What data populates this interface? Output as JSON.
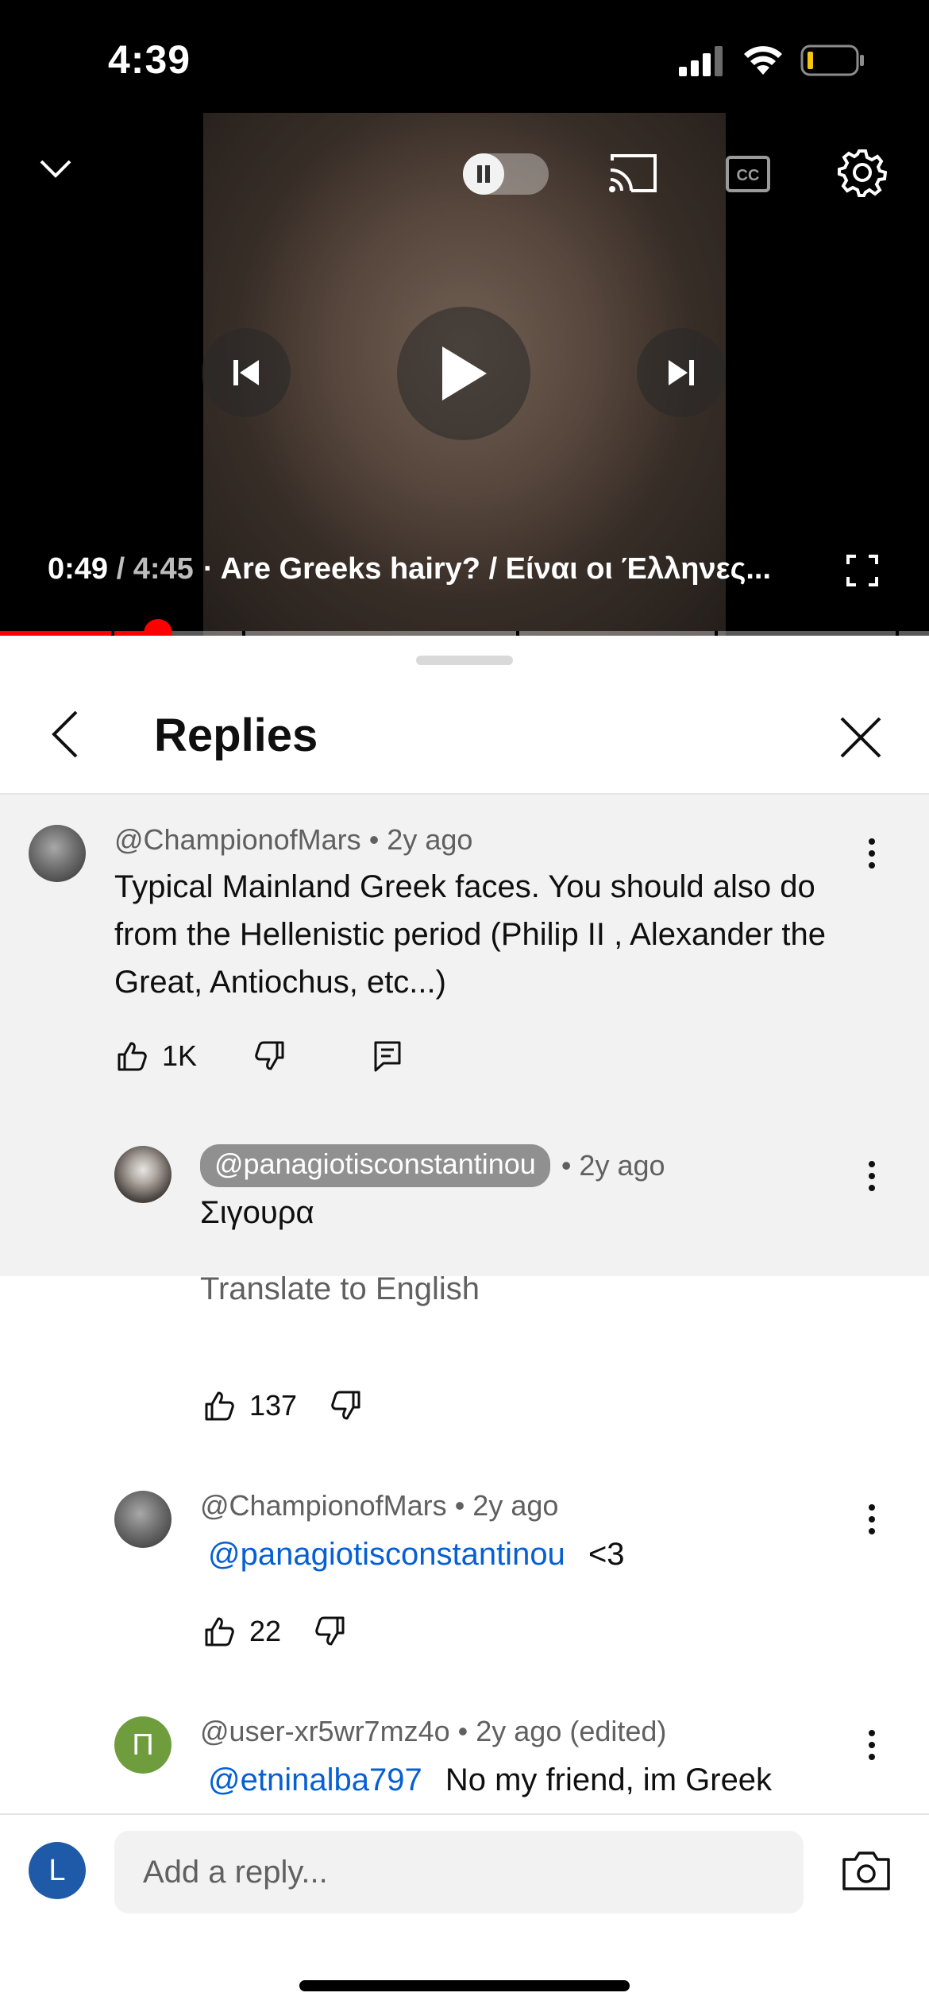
{
  "status_bar": {
    "time": "4:39"
  },
  "player": {
    "current_time": "0:49",
    "separator": "/",
    "duration": "4:45",
    "title": "· Are Greeks hairy? / Είναι οι Έλληνες...",
    "progress_fraction": 0.172,
    "autoplay": "on",
    "icons": [
      "chevron-down-icon",
      "autoplay-toggle",
      "cast-icon",
      "cc-icon",
      "settings-icon",
      "previous-icon",
      "play-icon",
      "next-icon",
      "fullscreen-icon"
    ]
  },
  "sheet": {
    "title": "Replies"
  },
  "parent_comment": {
    "author": "@ChampionofMars",
    "age": "• 2y ago",
    "text": "Typical Mainland Greek faces.  You should also do from the Hellenistic period (Philip II , Alexander the Great, Antiochus, etc...)",
    "likes": "1K"
  },
  "replies": [
    {
      "author": "@panagiotisconstantinou",
      "age": "• 2y ago",
      "text": "Σιγουρα",
      "translate_label": "Translate to English",
      "likes": "137"
    },
    {
      "author": "@ChampionofMars",
      "age": "• 2y ago",
      "mention": "@panagiotisconstantinou",
      "text": "<3",
      "likes": "22"
    },
    {
      "author": "@user-xr5wr7mz4o",
      "age": "• 2y ago (edited)",
      "avatar_letter": "П",
      "avatar_color": "#6f9d3e",
      "mention": "@etninalba797",
      "text": "No my friend, im Greek"
    }
  ],
  "composer": {
    "avatar_letter": "L",
    "placeholder": "Add a reply..."
  },
  "colors": {
    "accent_red": "#ff0000",
    "link_blue": "#065fd4",
    "user_avatar": "#1f5aa8"
  }
}
